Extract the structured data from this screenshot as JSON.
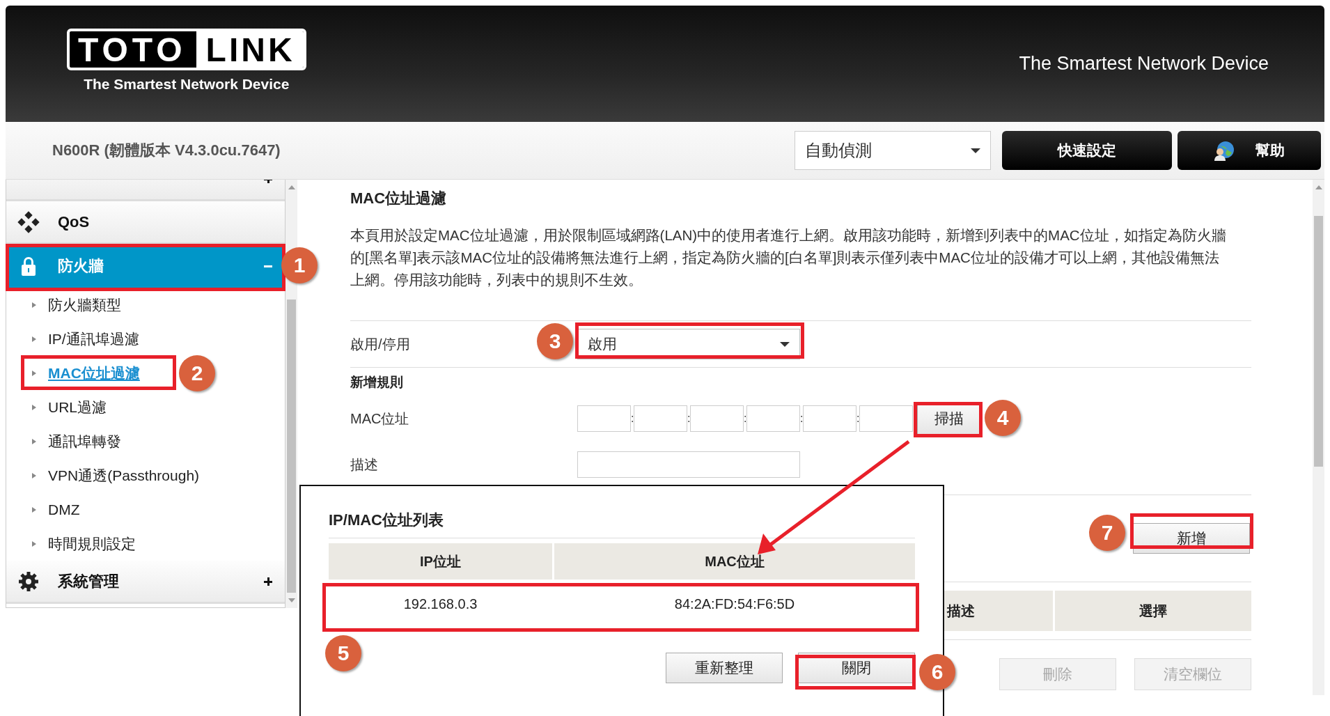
{
  "header": {
    "logo": {
      "word_1": "TOTO",
      "word_2": "LINK",
      "tagline": "The Smartest Network Device"
    },
    "slogan": "The Smartest Network Device"
  },
  "toolbar": {
    "model": "N600R (韌體版本 V4.3.0cu.7647)",
    "language": "自動偵測",
    "buttons": [
      {
        "label": "快速設定",
        "kind": "plain"
      },
      {
        "label": "幫助",
        "kind": "help"
      }
    ]
  },
  "sidebar": {
    "items": [
      {
        "expanded": false,
        "selected": false
      },
      {
        "label": "QoS",
        "kind": "qos",
        "selected": false
      },
      {
        "label": "防火牆",
        "kind": "lock",
        "expanded": true,
        "selected": true,
        "children": [
          {
            "label": "防火牆類型",
            "selected": false
          },
          {
            "label": "IP/通訊埠過濾",
            "selected": false
          },
          {
            "label": "MAC位址過濾",
            "selected": true
          },
          {
            "label": "URL過濾",
            "selected": false
          },
          {
            "label": "通訊埠轉發",
            "selected": false
          },
          {
            "label": "VPN通透(Passthrough)",
            "selected": false
          },
          {
            "label": "DMZ",
            "selected": false
          },
          {
            "label": "時間規則設定",
            "selected": false
          }
        ]
      },
      {
        "label": "系統管理",
        "kind": "gear",
        "expanded": false,
        "selected": false
      }
    ]
  },
  "main": {
    "title": "MAC位址過濾",
    "description": "本頁用於設定MAC位址過濾，用於限制區域網路(LAN)中的使用者進行上網。啟用該功能時，新增到列表中的MAC位址，如指定為防火牆的[黑名單]表示該MAC位址的設備將無法進行上網，指定為防火牆的[白名單]則表示僅列表中MAC位址的設備才可以上網，其他設備無法上網。停用該功能時，列表中的規則不生效。",
    "enable": {
      "label": "啟用/停用",
      "value": "啟用"
    },
    "section": "新增規則",
    "mac": {
      "label": "MAC位址",
      "separator": ":",
      "button": "掃描"
    },
    "note": {
      "label": "描述"
    },
    "add_button": "新增",
    "table": {
      "columns": [
        "描述",
        "選擇"
      ]
    },
    "buttons": [
      {
        "label": "刪除",
        "disabled": true
      },
      {
        "label": "清空欄位",
        "disabled": true
      }
    ]
  },
  "popup": {
    "title": "IP/MAC位址列表",
    "columns": [
      "IP位址",
      "MAC位址"
    ],
    "rows": [
      {
        "ip": "192.168.0.3",
        "mac": "84:2A:FD:54:F6:5D"
      }
    ],
    "buttons": [
      "重新整理",
      "關閉"
    ]
  },
  "callouts": [
    "1",
    "2",
    "3",
    "4",
    "5",
    "6",
    "7"
  ]
}
